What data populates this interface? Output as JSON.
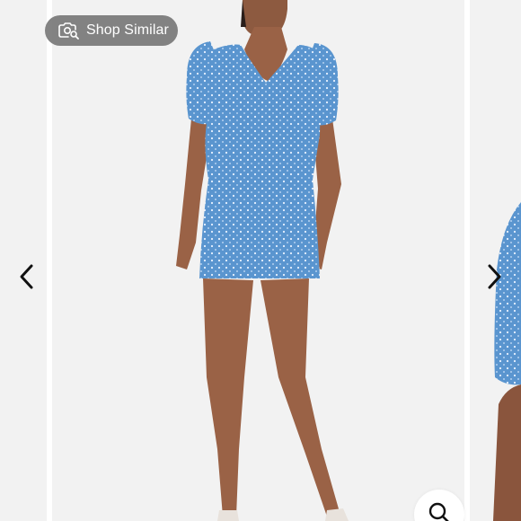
{
  "shop_similar": {
    "label": "Shop Similar",
    "icon": "camera-search-icon"
  },
  "nav": {
    "prev_icon": "chevron-left-icon",
    "next_icon": "chevron-right-icon"
  },
  "zoom": {
    "icon": "magnifier-icon"
  },
  "product_image": {
    "subject": "model-wearing-blue-polka-dot-puff-sleeve-mini-dress",
    "dress_color": "#5a95cf",
    "skin_color": "#9a6246",
    "background": "#f2f2f2"
  }
}
